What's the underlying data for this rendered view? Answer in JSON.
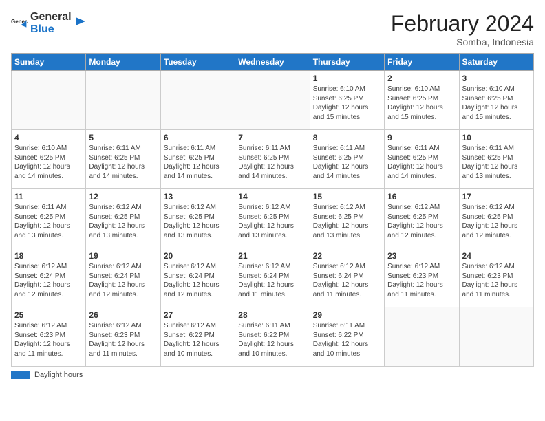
{
  "header": {
    "logo_general": "General",
    "logo_blue": "Blue",
    "month_title": "February 2024",
    "location": "Somba, Indonesia"
  },
  "footer": {
    "label": "Daylight hours"
  },
  "days_of_week": [
    "Sunday",
    "Monday",
    "Tuesday",
    "Wednesday",
    "Thursday",
    "Friday",
    "Saturday"
  ],
  "weeks": [
    [
      {
        "day": "",
        "info": ""
      },
      {
        "day": "",
        "info": ""
      },
      {
        "day": "",
        "info": ""
      },
      {
        "day": "",
        "info": ""
      },
      {
        "day": "1",
        "info": "Sunrise: 6:10 AM\nSunset: 6:25 PM\nDaylight: 12 hours and 15 minutes."
      },
      {
        "day": "2",
        "info": "Sunrise: 6:10 AM\nSunset: 6:25 PM\nDaylight: 12 hours and 15 minutes."
      },
      {
        "day": "3",
        "info": "Sunrise: 6:10 AM\nSunset: 6:25 PM\nDaylight: 12 hours and 15 minutes."
      }
    ],
    [
      {
        "day": "4",
        "info": "Sunrise: 6:10 AM\nSunset: 6:25 PM\nDaylight: 12 hours and 14 minutes."
      },
      {
        "day": "5",
        "info": "Sunrise: 6:11 AM\nSunset: 6:25 PM\nDaylight: 12 hours and 14 minutes."
      },
      {
        "day": "6",
        "info": "Sunrise: 6:11 AM\nSunset: 6:25 PM\nDaylight: 12 hours and 14 minutes."
      },
      {
        "day": "7",
        "info": "Sunrise: 6:11 AM\nSunset: 6:25 PM\nDaylight: 12 hours and 14 minutes."
      },
      {
        "day": "8",
        "info": "Sunrise: 6:11 AM\nSunset: 6:25 PM\nDaylight: 12 hours and 14 minutes."
      },
      {
        "day": "9",
        "info": "Sunrise: 6:11 AM\nSunset: 6:25 PM\nDaylight: 12 hours and 14 minutes."
      },
      {
        "day": "10",
        "info": "Sunrise: 6:11 AM\nSunset: 6:25 PM\nDaylight: 12 hours and 13 minutes."
      }
    ],
    [
      {
        "day": "11",
        "info": "Sunrise: 6:11 AM\nSunset: 6:25 PM\nDaylight: 12 hours and 13 minutes."
      },
      {
        "day": "12",
        "info": "Sunrise: 6:12 AM\nSunset: 6:25 PM\nDaylight: 12 hours and 13 minutes."
      },
      {
        "day": "13",
        "info": "Sunrise: 6:12 AM\nSunset: 6:25 PM\nDaylight: 12 hours and 13 minutes."
      },
      {
        "day": "14",
        "info": "Sunrise: 6:12 AM\nSunset: 6:25 PM\nDaylight: 12 hours and 13 minutes."
      },
      {
        "day": "15",
        "info": "Sunrise: 6:12 AM\nSunset: 6:25 PM\nDaylight: 12 hours and 13 minutes."
      },
      {
        "day": "16",
        "info": "Sunrise: 6:12 AM\nSunset: 6:25 PM\nDaylight: 12 hours and 12 minutes."
      },
      {
        "day": "17",
        "info": "Sunrise: 6:12 AM\nSunset: 6:25 PM\nDaylight: 12 hours and 12 minutes."
      }
    ],
    [
      {
        "day": "18",
        "info": "Sunrise: 6:12 AM\nSunset: 6:24 PM\nDaylight: 12 hours and 12 minutes."
      },
      {
        "day": "19",
        "info": "Sunrise: 6:12 AM\nSunset: 6:24 PM\nDaylight: 12 hours and 12 minutes."
      },
      {
        "day": "20",
        "info": "Sunrise: 6:12 AM\nSunset: 6:24 PM\nDaylight: 12 hours and 12 minutes."
      },
      {
        "day": "21",
        "info": "Sunrise: 6:12 AM\nSunset: 6:24 PM\nDaylight: 12 hours and 11 minutes."
      },
      {
        "day": "22",
        "info": "Sunrise: 6:12 AM\nSunset: 6:24 PM\nDaylight: 12 hours and 11 minutes."
      },
      {
        "day": "23",
        "info": "Sunrise: 6:12 AM\nSunset: 6:23 PM\nDaylight: 12 hours and 11 minutes."
      },
      {
        "day": "24",
        "info": "Sunrise: 6:12 AM\nSunset: 6:23 PM\nDaylight: 12 hours and 11 minutes."
      }
    ],
    [
      {
        "day": "25",
        "info": "Sunrise: 6:12 AM\nSunset: 6:23 PM\nDaylight: 12 hours and 11 minutes."
      },
      {
        "day": "26",
        "info": "Sunrise: 6:12 AM\nSunset: 6:23 PM\nDaylight: 12 hours and 11 minutes."
      },
      {
        "day": "27",
        "info": "Sunrise: 6:12 AM\nSunset: 6:22 PM\nDaylight: 12 hours and 10 minutes."
      },
      {
        "day": "28",
        "info": "Sunrise: 6:11 AM\nSunset: 6:22 PM\nDaylight: 12 hours and 10 minutes."
      },
      {
        "day": "29",
        "info": "Sunrise: 6:11 AM\nSunset: 6:22 PM\nDaylight: 12 hours and 10 minutes."
      },
      {
        "day": "",
        "info": ""
      },
      {
        "day": "",
        "info": ""
      }
    ]
  ]
}
